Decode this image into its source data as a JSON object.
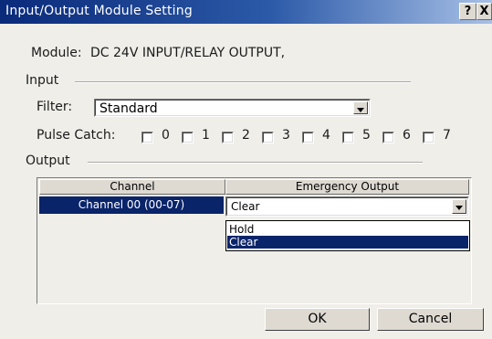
{
  "window": {
    "title": "Input/Output Module Setting",
    "help_button": "?",
    "close_button": "X"
  },
  "module": {
    "label": "Module:",
    "value": "DC 24V INPUT/RELAY OUTPUT,"
  },
  "input_group": {
    "label": "Input",
    "filter_label": "Filter:",
    "filter_value": "Standard",
    "pulse_catch_label": "Pulse Catch:",
    "pulse_catch_channels": [
      "0",
      "1",
      "2",
      "3",
      "4",
      "5",
      "6",
      "7"
    ]
  },
  "output_group": {
    "label": "Output",
    "table": {
      "columns": [
        "Channel",
        "Emergency Output"
      ],
      "rows": [
        {
          "channel": "Channel 00 (00-07)",
          "emergency_output": "Clear"
        }
      ]
    },
    "dropdown_options": [
      "Hold",
      "Clear"
    ],
    "dropdown_selected": "Clear"
  },
  "buttons": {
    "ok": "OK",
    "cancel": "Cancel"
  }
}
